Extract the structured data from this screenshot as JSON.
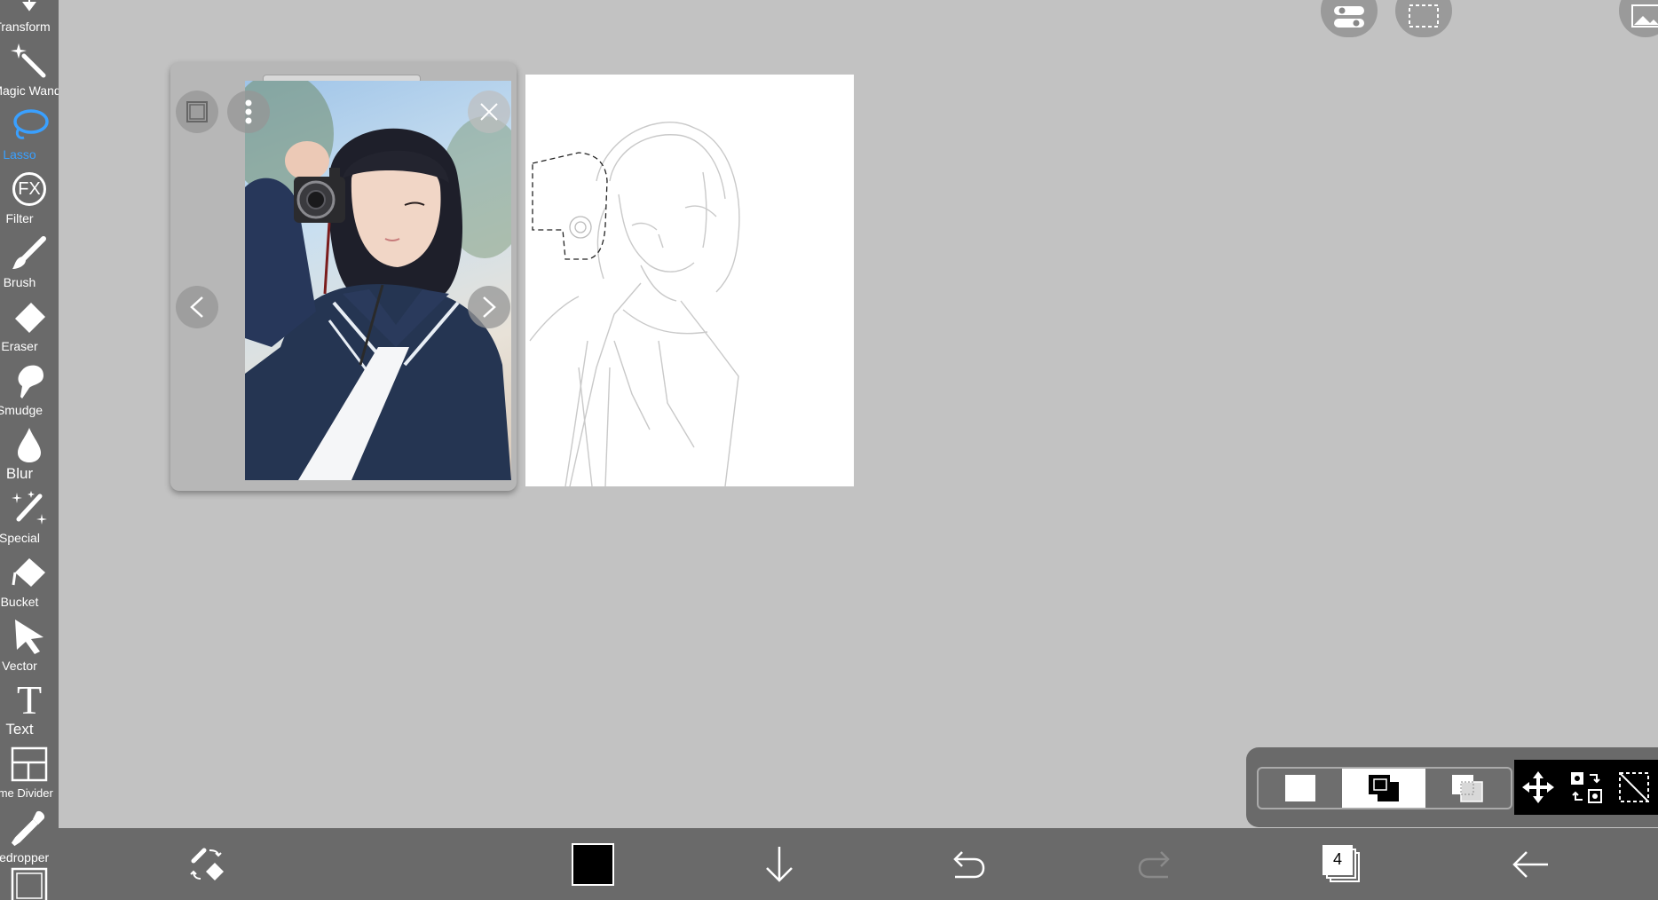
{
  "toolbar": {
    "tools": [
      {
        "label": "Transform",
        "icon": "transform-icon",
        "active": false
      },
      {
        "label": "Magic Wand",
        "icon": "magic-wand-icon",
        "active": false
      },
      {
        "label": "Lasso",
        "icon": "lasso-icon",
        "active": true
      },
      {
        "label": "Filter",
        "icon": "fx-filter-icon",
        "active": false
      },
      {
        "label": "Brush",
        "icon": "brush-icon",
        "active": false
      },
      {
        "label": "Eraser",
        "icon": "eraser-icon",
        "active": false
      },
      {
        "label": "Smudge",
        "icon": "smudge-icon",
        "active": false
      },
      {
        "label": "Blur",
        "icon": "blur-drop-icon",
        "active": false
      },
      {
        "label": "Special",
        "icon": "special-icon",
        "active": false
      },
      {
        "label": "Bucket",
        "icon": "bucket-icon",
        "active": false
      },
      {
        "label": "Vector",
        "icon": "vector-arrow-icon",
        "active": false
      },
      {
        "label": "Text",
        "icon": "text-icon",
        "active": false
      },
      {
        "label": "Frame Divider",
        "icon": "frame-divider-icon",
        "active": false
      },
      {
        "label": "Eyedropper",
        "icon": "eyedropper-icon",
        "active": false
      },
      {
        "label": "",
        "icon": "canvas-icon",
        "active": false
      }
    ],
    "filter_glyph": "FX",
    "text_glyph": "T"
  },
  "reference_window": {
    "icons": [
      "frame-icon",
      "more-vertical-icon",
      "close-icon",
      "prev-arrow-icon",
      "next-arrow-icon"
    ]
  },
  "selection_panel": {
    "modes": [
      "new-selection-icon",
      "add-selection-icon",
      "subtract-selection-icon"
    ],
    "active_mode": 1,
    "actions": [
      "move-icon",
      "transform-selection-icon",
      "deselect-icon"
    ]
  },
  "bottom_bar": {
    "layer_count": "4",
    "current_color": "#000000"
  },
  "colors": {
    "toolbar_bg": "#6a6a6a",
    "canvas_bg": "#c2c2c2",
    "active_tool": "#3aa0ff"
  }
}
